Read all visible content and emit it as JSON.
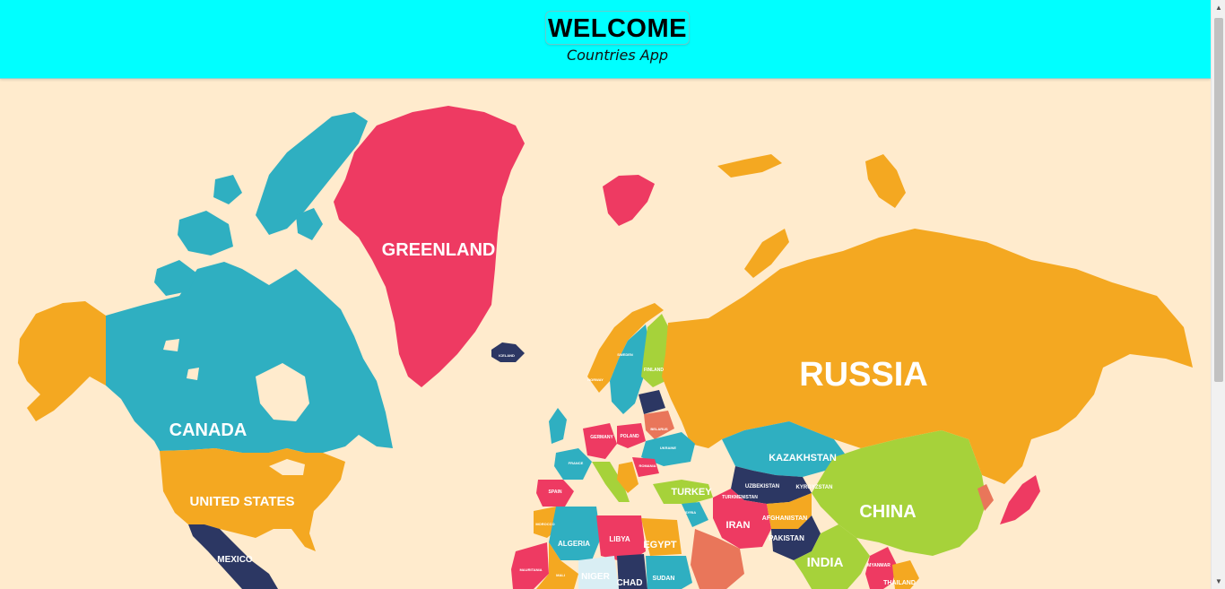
{
  "header": {
    "title": "WELCOME",
    "subtitle": "Countries App"
  },
  "map": {
    "labels": {
      "greenland": "GREENLAND",
      "canada": "CANADA",
      "united_states": "UNITED STATES",
      "mexico": "MEXICO",
      "russia": "RUSSIA",
      "china": "CHINA",
      "india": "INDIA",
      "kazakhstan": "KAZAKHSTAN",
      "iran": "IRAN",
      "turkey": "TURKEY",
      "egypt": "EGYPT",
      "libya": "LIBYA",
      "algeria": "ALGERIA",
      "niger": "NIGER",
      "chad": "CHAD",
      "sudan": "SUDAN",
      "afghanistan": "AFGHANISTAN",
      "pakistan": "PAKISTAN",
      "uzbekistan": "UZBEKISTAN",
      "kyrgyzstan": "KYRGYZSTAN",
      "turkmenistan": "TURKMENISTAN",
      "iceland": "ICELAND",
      "finland": "FINLAND",
      "sweden": "SWEDEN",
      "norway": "NORWAY",
      "poland": "POLAND",
      "germany": "GERMANY",
      "france": "FRANCE",
      "spain": "SPAIN",
      "ukraine": "UKRAINE",
      "belarus": "BELARUS",
      "romania": "ROMANIA",
      "morocco": "MOROCCO",
      "mauritania": "MAURITANIA",
      "mali": "MALI",
      "syria": "SYRIA",
      "thailand": "THAILAND",
      "myanmar": "MYANMAR"
    }
  },
  "colors": {
    "header_bg": "#00ffff",
    "ocean": "#ffebcd",
    "teal": "#2fafc1",
    "pink": "#ee3a62",
    "orange": "#f4a821",
    "navy": "#2c3763",
    "green": "#a6d23a",
    "coral": "#e9765a"
  }
}
